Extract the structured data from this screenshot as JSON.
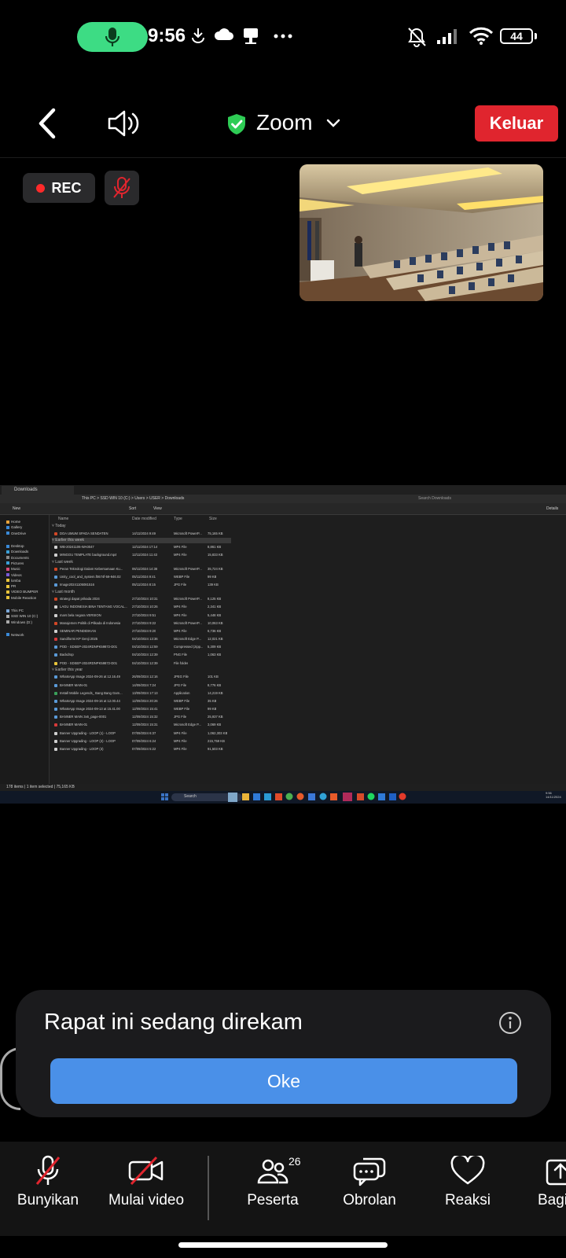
{
  "status_bar": {
    "time": "9:56",
    "battery": "44",
    "icons": [
      "mic-icon",
      "download-icon",
      "cloud-icon",
      "sim-icon",
      "more-dots-icon",
      "vibrate-off-icon",
      "signal-icon",
      "wifi-icon",
      "battery-icon"
    ]
  },
  "header": {
    "meeting_title": "Zoom",
    "leave_label": "Keluar",
    "accent_green": "#2ecc55",
    "leave_color": "#e0252e"
  },
  "recording": {
    "rec_label": "REC"
  },
  "shared_screen": {
    "window_title": "Downloads",
    "address": [
      "This PC",
      "SSD WIN 10 (C:)",
      "Users",
      "USER",
      "Downloads"
    ],
    "search_placeholder": "Search Downloads",
    "toolbar": [
      "New",
      "Sort",
      "View",
      "Details"
    ],
    "columns": [
      "Name",
      "Date modified",
      "Type",
      "Size"
    ],
    "sidebar": [
      "Home",
      "Gallery",
      "OneDrive",
      "Desktop",
      "Downloads",
      "Documents",
      "Pictures",
      "Music",
      "Videos",
      "lomba",
      "PR",
      "VIDEO BUMPER",
      "Mobile Reaction",
      "This PC",
      "SSD WIN 10 (C:)",
      "Windows (D:)",
      "Network"
    ],
    "groups": [
      {
        "label": "Today",
        "rows": [
          [
            "DOA UMUM SPADA SENDATEN",
            "14/11/2024 9:49",
            "Microsoft PowerP...",
            "75,165 KB"
          ]
        ]
      },
      {
        "label": "Earlier this week",
        "rows": [
          [
            "WB-20241106-WA0047",
            "12/11/2024 17:14",
            "MP4 File",
            "8,861 KB"
          ],
          [
            "MINGGU TEMPLATE background.mp4",
            "12/11/2024 11:43",
            "MP4 File",
            "15,833 KB"
          ]
        ]
      },
      {
        "label": "Last week",
        "rows": [
          [
            "Peran Teknologi Dalam Kebersamaan Ku...",
            "06/11/2024 14:36",
            "Microsoft PowerP...",
            "35,724 KB"
          ],
          [
            "Unity_cool_and_system.f0674f-59-946.02",
            "05/11/2024 9:41",
            "WEBP File",
            "99 KB"
          ],
          [
            "Image20241105081516",
            "05/11/2024 8:15",
            "JPG File",
            "139 KB"
          ]
        ]
      },
      {
        "label": "Last month",
        "rows": [
          [
            "strategi dapat prikada 2024",
            "27/10/2024 10:31",
            "Microsoft PowerP...",
            "8,125 KB"
          ],
          [
            "LAGU INDONESIA BINA TENTANG VOCAL...",
            "27/10/2024 10:26",
            "MP4 File",
            "2,341 KB"
          ],
          [
            "mars bela negara VERSION",
            "27/10/2024 9:51",
            "MP4 File",
            "5,448 KB"
          ],
          [
            "Manajemen Politik di Pilkada di Indonesia",
            "27/10/2024 9:22",
            "Microsoft PowerP...",
            "10,063 KB"
          ],
          [
            "SEMINAR PENDIDIKAN",
            "27/10/2024 9:20",
            "MP4 File",
            "6,736 KB"
          ],
          [
            "Sandiformi KP Genji 2025",
            "04/10/2024 13:36",
            "Microsoft Edge P...",
            "12,021 KB"
          ],
          [
            "POD - SDSEP-2024RDNPK59872-D01",
            "04/10/2024 12:59",
            "Compressed (zipp...",
            "5,309 KB"
          ],
          [
            "Backdrop",
            "04/10/2024 12:39",
            "PNG File",
            "1,063 KB"
          ],
          [
            "POD - SDSEP-2024RDNPK59872-D01",
            "04/10/2024 12:39",
            "File folder",
            ""
          ]
        ]
      },
      {
        "label": "Earlier this year",
        "rows": [
          [
            "WhatsApp Image 2024-09-26 at 12.16.49",
            "26/09/2024 12:16",
            "JPEG File",
            "101 KB"
          ],
          [
            "BANNER MAIN-01",
            "14/09/2024 7:24",
            "JPG File",
            "8,776 KB"
          ],
          [
            "Install Mobile Legends_ Bang Bang Gam...",
            "13/09/2024 17:13",
            "Application",
            "14,219 KB"
          ],
          [
            "WhatsApp Image 2024-09-16 at 12.00.44",
            "12/09/2024 20:26",
            "WEBP File",
            "35 KB"
          ],
          [
            "WhatsApp Image 2024-09-13 at 15.41.00",
            "12/09/2024 15:41",
            "WEBP File",
            "99 KB"
          ],
          [
            "BANNER MAIN 3x6_page-0001",
            "12/09/2024 15:32",
            "JPG File",
            "25,937 KB"
          ],
          [
            "BANNER MAIN-01",
            "12/09/2024 15:31",
            "Microsoft Edge P...",
            "3,069 KB"
          ],
          [
            "Banner Upgrading - LOOP (1) - LOOP",
            "07/09/2024 6:37",
            "MP4 File",
            "1,062,303 KB"
          ],
          [
            "Banner Upgrading - LOOP (2) - LOOP",
            "07/09/2024 6:24",
            "MP4 File",
            "215,759 KB"
          ],
          [
            "Banner Upgrading - LOOP (3)",
            "07/09/2024 5:22",
            "MP4 File",
            "91,503 KB"
          ]
        ]
      }
    ],
    "status_text": "178 items  |  1 item selected  |  75,165 KB",
    "taskbar_search": "Search",
    "taskbar_time": "9:56",
    "taskbar_date": "14/11/2024"
  },
  "popup": {
    "message": "Rapat ini sedang direkam",
    "ok_label": "Oke"
  },
  "toolbar": {
    "unmute_label": "Bunyikan",
    "video_label": "Mulai video",
    "participants_label": "Peserta",
    "participants_count": "26",
    "chat_label": "Obrolan",
    "reactions_label": "Reaksi",
    "share_label": "Bagi"
  }
}
